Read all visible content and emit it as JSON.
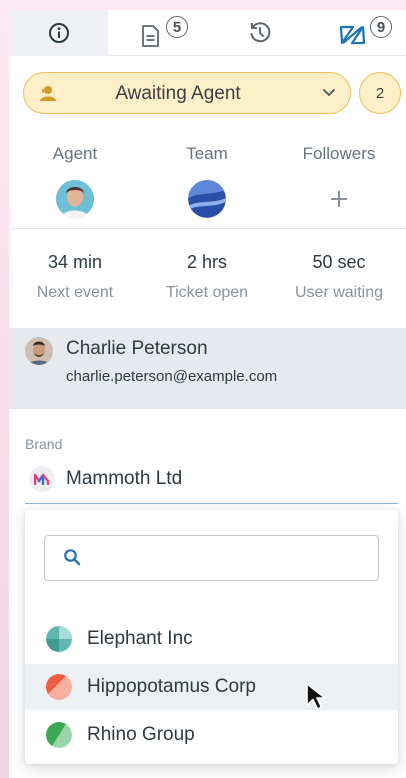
{
  "tabs": [
    {
      "name": "info",
      "icon": "info-icon",
      "active": true
    },
    {
      "name": "notes",
      "icon": "document-icon",
      "badge": "5"
    },
    {
      "name": "history",
      "icon": "history-icon"
    },
    {
      "name": "apps",
      "icon": "apps-logo-icon",
      "badge": "9"
    }
  ],
  "status": {
    "label": "Awaiting Agent",
    "count": "2",
    "color": "#fdefc7",
    "border": "#efbd5a"
  },
  "people": {
    "agent_label": "Agent",
    "team_label": "Team",
    "followers_label": "Followers",
    "followers_add": "+"
  },
  "stats": [
    {
      "value": "34 min",
      "caption": "Next event"
    },
    {
      "value": "2 hrs",
      "caption": "Ticket open"
    },
    {
      "value": "50 sec",
      "caption": "User waiting"
    }
  ],
  "requester": {
    "name": "Charlie Peterson",
    "email": "charlie.peterson@example.com"
  },
  "brand": {
    "label": "Brand",
    "value": "Mammoth Ltd",
    "search_placeholder": "",
    "options": [
      {
        "label": "Elephant Inc"
      },
      {
        "label": "Hippopotamus Corp"
      },
      {
        "label": "Rhino Group"
      }
    ]
  }
}
